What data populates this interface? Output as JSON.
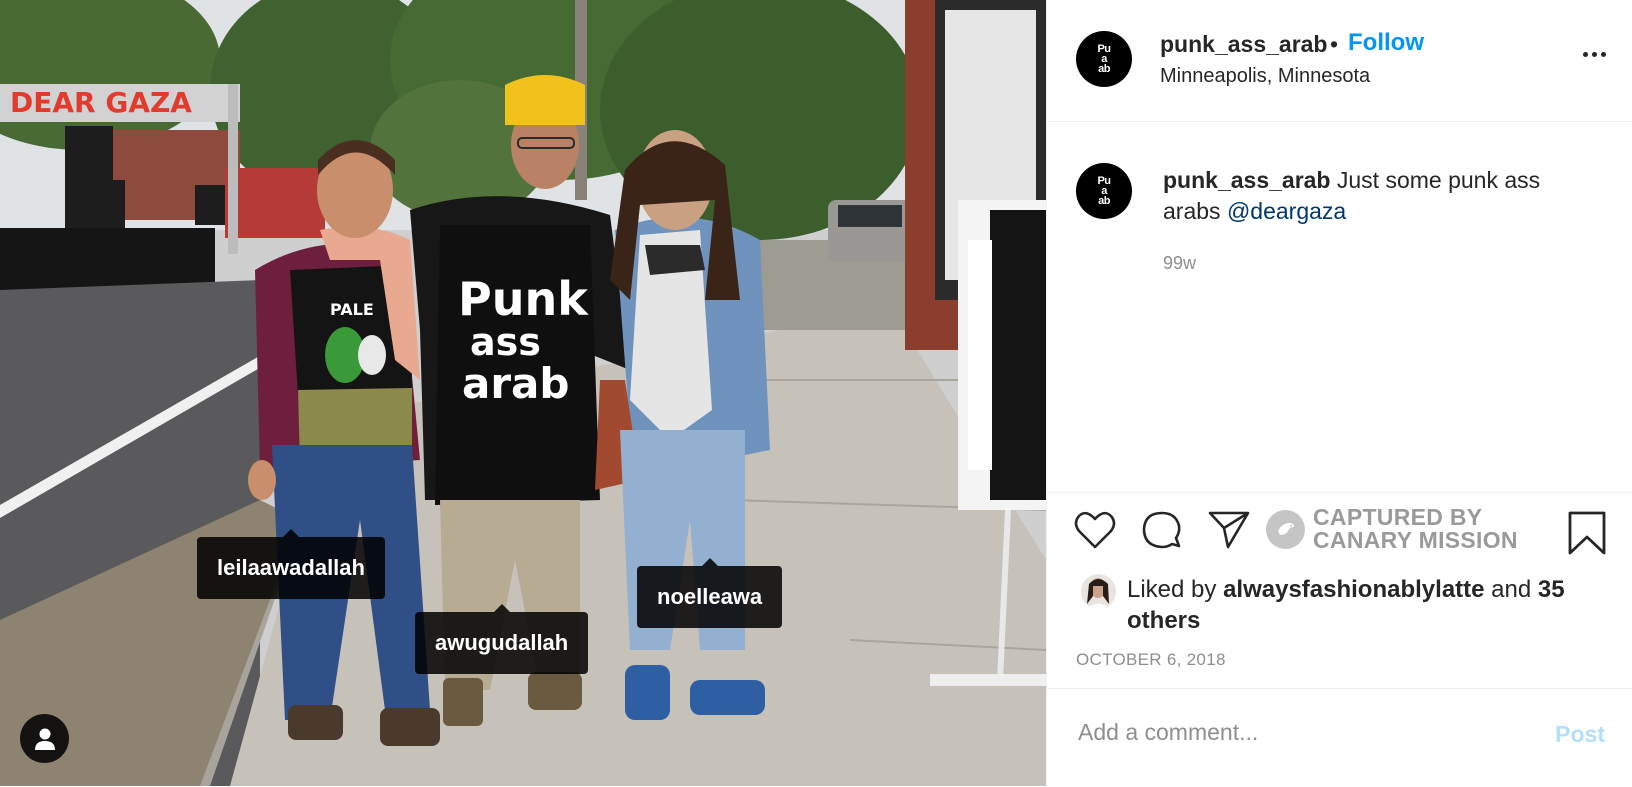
{
  "photo": {
    "banner_text": "DEAR GAZA",
    "shirt_text": [
      "Punk",
      "ass",
      "arab"
    ],
    "tags": [
      {
        "username": "leilaawadallah"
      },
      {
        "username": "awugudallah"
      },
      {
        "username": "noelleawa"
      }
    ],
    "user_tags_icon": "person-icon"
  },
  "header": {
    "username": "punk_ass_arab",
    "separator": "•",
    "follow_label": "Follow",
    "location": "Minneapolis, Minnesota",
    "more_icon": "ellipsis-icon"
  },
  "caption": {
    "username": "punk_ass_arab",
    "text": "Just some punk ass arabs",
    "mention": "@deargaza",
    "age": "99w"
  },
  "actions": {
    "icons": [
      "heart-icon",
      "comment-icon",
      "share-icon",
      "bookmark-icon"
    ],
    "overlay_label_line1": "CAPTURED BY",
    "overlay_label_line2": "CANARY MISSION"
  },
  "likes": {
    "prefix": "Liked by",
    "liker": "alwaysfashionablylatte",
    "conjunction": "and",
    "others": "35 others"
  },
  "date": "OCTOBER 6, 2018",
  "comment_box": {
    "placeholder": "Add a comment...",
    "post_label": "Post"
  },
  "colors": {
    "accent": "#0095f6",
    "post_disabled": "#b2dffc",
    "mention": "#00376b",
    "muted": "#8e8e8e"
  }
}
